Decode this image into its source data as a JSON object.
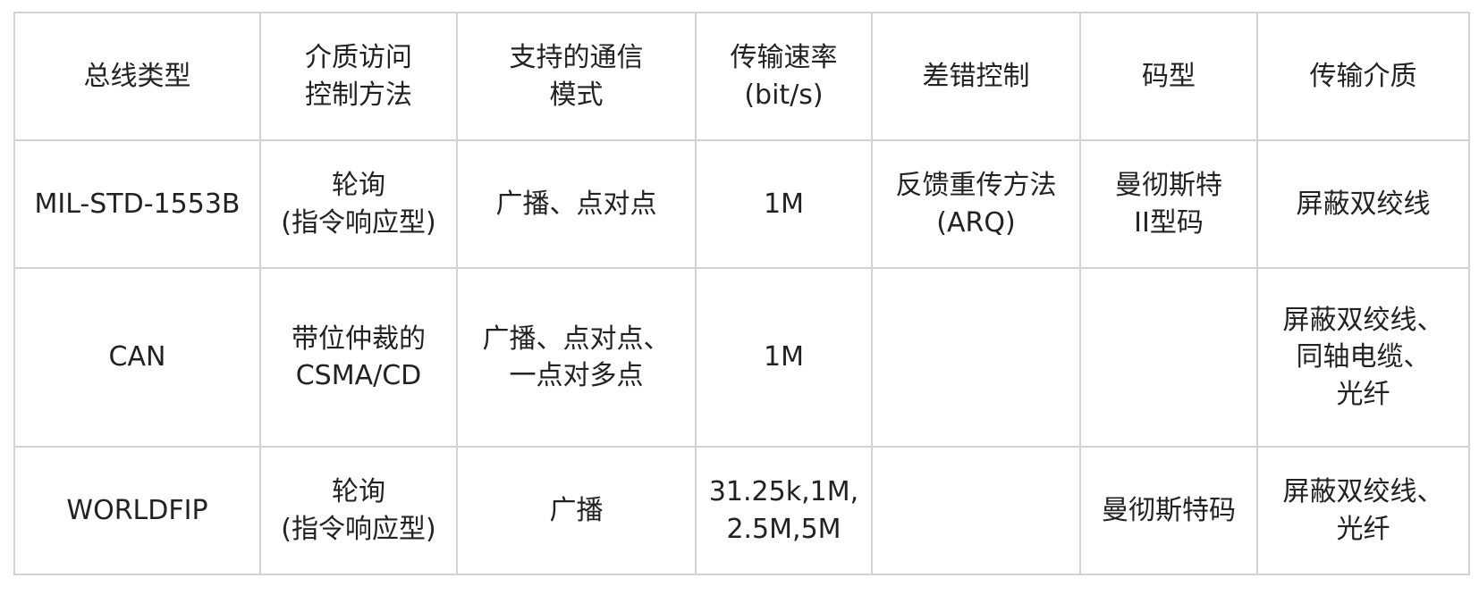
{
  "table": {
    "headers": [
      "总线类型",
      "介质访问\n控制方法",
      "支持的通信\n模式",
      "传输速率\n(bit/s)",
      "差错控制",
      "码型",
      "传输介质"
    ],
    "rows": [
      {
        "bus_type": "MIL-STD-1553B",
        "access_control": "轮询\n(指令响应型)",
        "comm_mode": "广播、点对点",
        "rate": "1M",
        "error_control": "反馈重传方法\n(ARQ)",
        "coding": "曼彻斯特\nII型码",
        "medium": "屏蔽双绞线"
      },
      {
        "bus_type": "CAN",
        "access_control": "带位仲裁的\nCSMA/CD",
        "comm_mode": "广播、点对点、\n一点对多点",
        "rate": "1M",
        "error_control": "",
        "coding": "",
        "medium": "屏蔽双绞线、\n同轴电缆、\n光纤"
      },
      {
        "bus_type": "WORLDFIP",
        "access_control": "轮询\n(指令响应型)",
        "comm_mode": "广播",
        "rate": "31.25k,1M,\n2.5M,5M",
        "error_control": "",
        "coding": "曼彻斯特码",
        "medium": "屏蔽双绞线、\n光纤"
      }
    ]
  }
}
